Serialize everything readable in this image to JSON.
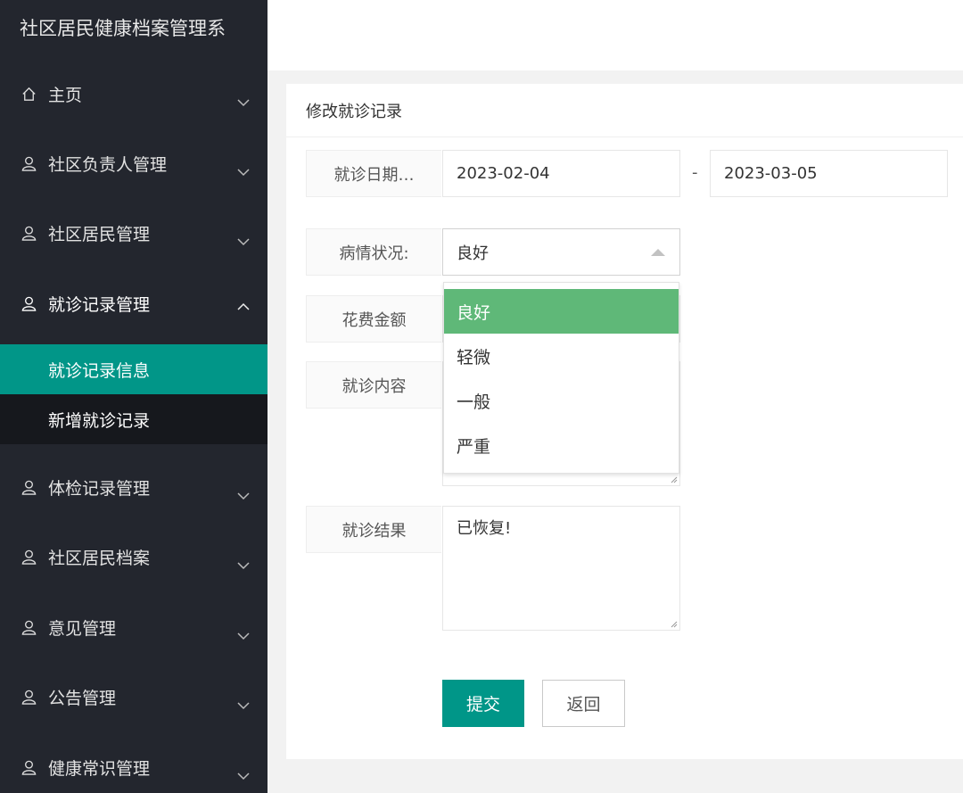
{
  "app": {
    "title": "社区居民健康档案管理系"
  },
  "sidebar": {
    "items": [
      {
        "label": "主页",
        "icon": "home-icon"
      },
      {
        "label": "社区负责人管理",
        "icon": "user-icon"
      },
      {
        "label": "社区居民管理",
        "icon": "user-icon"
      },
      {
        "label": "就诊记录管理",
        "icon": "user-icon",
        "expanded": true,
        "children": [
          {
            "label": "就诊记录信息",
            "active": true
          },
          {
            "label": "新增就诊记录"
          }
        ]
      },
      {
        "label": "体检记录管理",
        "icon": "user-icon"
      },
      {
        "label": "社区居民档案",
        "icon": "user-icon"
      },
      {
        "label": "意见管理",
        "icon": "user-icon"
      },
      {
        "label": "公告管理",
        "icon": "user-icon"
      },
      {
        "label": "健康常识管理",
        "icon": "user-icon"
      }
    ]
  },
  "form": {
    "title": "修改就诊记录",
    "visit_date": {
      "label": "就诊日期…",
      "start": "2023-02-04",
      "separator": "-",
      "end": "2023-03-05"
    },
    "condition": {
      "label": "病情状况:",
      "value": "良好",
      "options": [
        "良好",
        "轻微",
        "一般",
        "严重"
      ]
    },
    "cost": {
      "label": "花费金额"
    },
    "content": {
      "label": "就诊内容"
    },
    "result": {
      "label": "就诊结果",
      "value": "已恢复!"
    },
    "submit_label": "提交",
    "back_label": "返回"
  },
  "colors": {
    "sidebar_bg": "#23262e",
    "active": "#009688",
    "option_selected": "#5fb878"
  }
}
